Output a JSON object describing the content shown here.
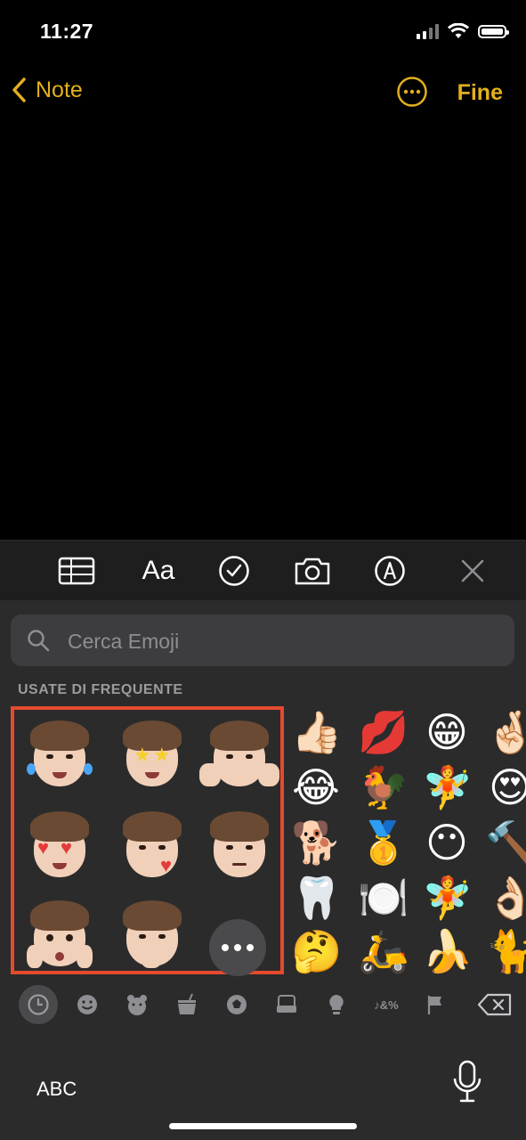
{
  "status": {
    "time": "11:27"
  },
  "nav": {
    "back_label": "Note",
    "done_label": "Fine"
  },
  "toolbar": {
    "items": [
      "table-icon",
      "format-icon",
      "checklist-icon",
      "camera-icon",
      "markup-icon",
      "close-icon"
    ],
    "format_label": "Aa"
  },
  "keyboard": {
    "search_placeholder": "Cerca Emoji",
    "section_title": "USATE DI FREQUENTE",
    "emoji": [
      [
        "👍🏻",
        "💋",
        "😁",
        "🤞🏻"
      ],
      [
        "😂",
        "🐓",
        "🧚",
        "😍"
      ],
      [
        "🐕",
        "🥇",
        "😶",
        "🔨"
      ],
      [
        "🦷",
        "🍽️",
        "🧚",
        "👌🏻"
      ],
      [
        "🤔",
        "🛵",
        "🍌",
        "🐈"
      ]
    ],
    "categories": [
      "recent-icon",
      "smiley-icon",
      "animal-icon",
      "food-icon",
      "activity-icon",
      "travel-icon",
      "objects-icon",
      "symbols-icon",
      "flags-icon"
    ],
    "abc_label": "ABC"
  },
  "colors": {
    "accent": "#e3b01e",
    "highlight": "#e64a2e",
    "keyboard_bg": "#2b2b2b"
  }
}
